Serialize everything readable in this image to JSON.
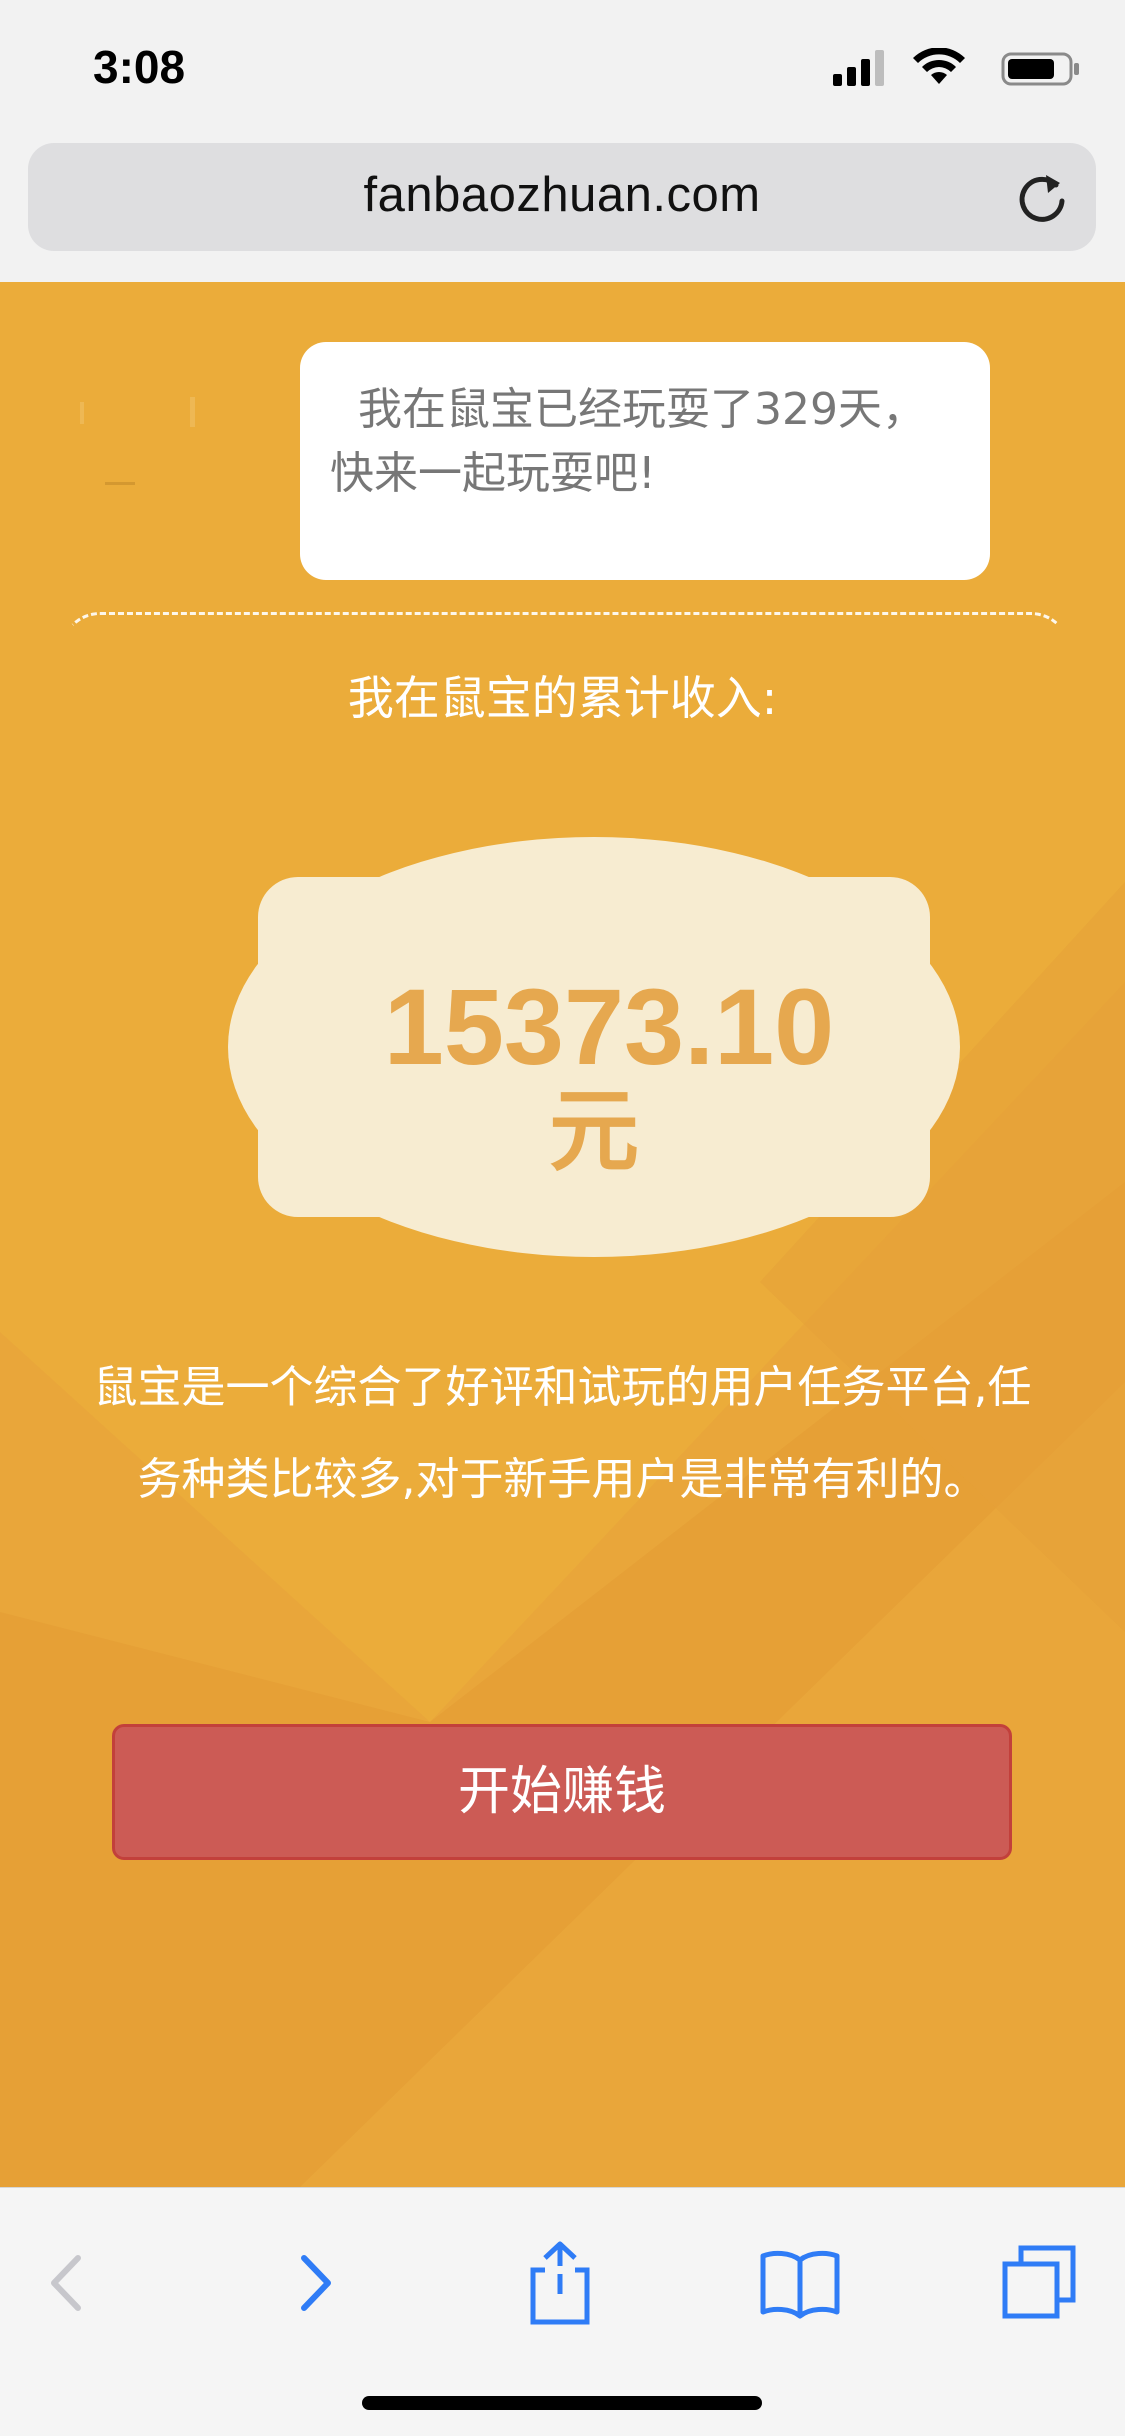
{
  "status_bar": {
    "time": "3:08",
    "icons": [
      "cellular-signal-icon",
      "wifi-icon",
      "battery-icon"
    ]
  },
  "browser": {
    "url": "fanbaozhuan.com",
    "reload_icon": "reload-icon"
  },
  "page": {
    "speech_bubble_text": "我在鼠宝已经玩耍了329天，快来一起玩耍吧!",
    "income_label": "我在鼠宝的累计收入:",
    "amount": "15373.10",
    "amount_unit": "元",
    "description": "鼠宝是一个综合了好评和试玩的用户任务平台,任务种类比较多,对于新手用户是非常有利的。",
    "start_button_label": "开始赚钱"
  },
  "toolbar": {
    "icons": [
      "back-icon",
      "forward-icon",
      "share-icon",
      "bookmarks-icon",
      "tabs-icon"
    ]
  },
  "colors": {
    "page_background": "#ebac3a",
    "amount_color": "#e6a84f",
    "button_red": "#cc5b55",
    "ios_blue": "#2f7cf6"
  }
}
